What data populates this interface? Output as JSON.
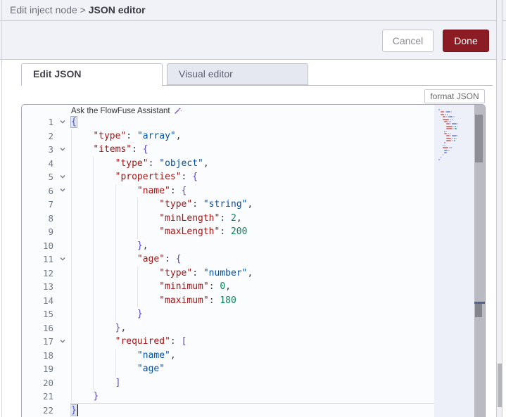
{
  "breadcrumb": {
    "parent": "Edit inject node",
    "separator": ">",
    "current": "JSON editor"
  },
  "buttons": {
    "cancel": "Cancel",
    "done": "Done",
    "format": "format JSON"
  },
  "tabs": [
    {
      "label": "Edit JSON",
      "active": true
    },
    {
      "label": "Visual editor",
      "active": false
    }
  ],
  "assistant": {
    "label": "Ask the FlowFuse Assistant",
    "icon": "wand-sparkle-icon"
  },
  "colors": {
    "done_button": "#8c1c23",
    "token_key": "#a31515",
    "token_string": "#0451a5",
    "token_number": "#098658",
    "token_bracket": "#5a47c4",
    "token_matched_bracket": "#4653b8",
    "token_punct": "#3c3c43",
    "bracket_match_bg": "#e2e6f2",
    "bracket_match_border": "#a6aec8",
    "line_number": "#6e7681"
  },
  "editor": {
    "language": "json",
    "line_count": 22,
    "lines": [
      {
        "n": 1,
        "indent": 0,
        "fold": true,
        "tokens": [
          [
            "mb",
            "{"
          ]
        ]
      },
      {
        "n": 2,
        "indent": 4,
        "fold": false,
        "tokens": [
          [
            "k",
            "\"type\""
          ],
          [
            "p",
            ": "
          ],
          [
            "s",
            "\"array\""
          ],
          [
            "p",
            ","
          ]
        ]
      },
      {
        "n": 3,
        "indent": 4,
        "fold": true,
        "tokens": [
          [
            "k",
            "\"items\""
          ],
          [
            "p",
            ": "
          ],
          [
            "b",
            "{"
          ]
        ]
      },
      {
        "n": 4,
        "indent": 8,
        "fold": false,
        "tokens": [
          [
            "k",
            "\"type\""
          ],
          [
            "p",
            ": "
          ],
          [
            "s",
            "\"object\""
          ],
          [
            "p",
            ","
          ]
        ]
      },
      {
        "n": 5,
        "indent": 8,
        "fold": true,
        "tokens": [
          [
            "k",
            "\"properties\""
          ],
          [
            "p",
            ": "
          ],
          [
            "b",
            "{"
          ]
        ]
      },
      {
        "n": 6,
        "indent": 12,
        "fold": true,
        "tokens": [
          [
            "k",
            "\"name\""
          ],
          [
            "p",
            ": "
          ],
          [
            "b",
            "{"
          ]
        ]
      },
      {
        "n": 7,
        "indent": 16,
        "fold": false,
        "tokens": [
          [
            "k",
            "\"type\""
          ],
          [
            "p",
            ": "
          ],
          [
            "s",
            "\"string\""
          ],
          [
            "p",
            ","
          ]
        ]
      },
      {
        "n": 8,
        "indent": 16,
        "fold": false,
        "tokens": [
          [
            "k",
            "\"minLength\""
          ],
          [
            "p",
            ": "
          ],
          [
            "num",
            "2"
          ],
          [
            "p",
            ","
          ]
        ]
      },
      {
        "n": 9,
        "indent": 16,
        "fold": false,
        "tokens": [
          [
            "k",
            "\"maxLength\""
          ],
          [
            "p",
            ": "
          ],
          [
            "num",
            "200"
          ]
        ]
      },
      {
        "n": 10,
        "indent": 12,
        "fold": false,
        "tokens": [
          [
            "b",
            "}"
          ],
          [
            "p",
            ","
          ]
        ]
      },
      {
        "n": 11,
        "indent": 12,
        "fold": true,
        "tokens": [
          [
            "k",
            "\"age\""
          ],
          [
            "p",
            ": "
          ],
          [
            "b",
            "{"
          ]
        ]
      },
      {
        "n": 12,
        "indent": 16,
        "fold": false,
        "tokens": [
          [
            "k",
            "\"type\""
          ],
          [
            "p",
            ": "
          ],
          [
            "s",
            "\"number\""
          ],
          [
            "p",
            ","
          ]
        ]
      },
      {
        "n": 13,
        "indent": 16,
        "fold": false,
        "tokens": [
          [
            "k",
            "\"minimum\""
          ],
          [
            "p",
            ": "
          ],
          [
            "num",
            "0"
          ],
          [
            "p",
            ","
          ]
        ]
      },
      {
        "n": 14,
        "indent": 16,
        "fold": false,
        "tokens": [
          [
            "k",
            "\"maximum\""
          ],
          [
            "p",
            ": "
          ],
          [
            "num",
            "180"
          ]
        ]
      },
      {
        "n": 15,
        "indent": 12,
        "fold": false,
        "tokens": [
          [
            "b",
            "}"
          ]
        ]
      },
      {
        "n": 16,
        "indent": 8,
        "fold": false,
        "tokens": [
          [
            "b",
            "}"
          ],
          [
            "p",
            ","
          ]
        ]
      },
      {
        "n": 17,
        "indent": 8,
        "fold": true,
        "tokens": [
          [
            "k",
            "\"required\""
          ],
          [
            "p",
            ": "
          ],
          [
            "b",
            "["
          ]
        ]
      },
      {
        "n": 18,
        "indent": 12,
        "fold": false,
        "tokens": [
          [
            "s",
            "\"name\""
          ],
          [
            "p",
            ","
          ]
        ]
      },
      {
        "n": 19,
        "indent": 12,
        "fold": false,
        "tokens": [
          [
            "s",
            "\"age\""
          ]
        ]
      },
      {
        "n": 20,
        "indent": 8,
        "fold": false,
        "tokens": [
          [
            "b",
            "]"
          ]
        ]
      },
      {
        "n": 21,
        "indent": 4,
        "fold": false,
        "tokens": [
          [
            "b",
            "}"
          ]
        ]
      },
      {
        "n": 22,
        "indent": 0,
        "fold": false,
        "tokens": [
          [
            "mb",
            "}"
          ]
        ],
        "cursor": true,
        "current": true
      }
    ]
  }
}
